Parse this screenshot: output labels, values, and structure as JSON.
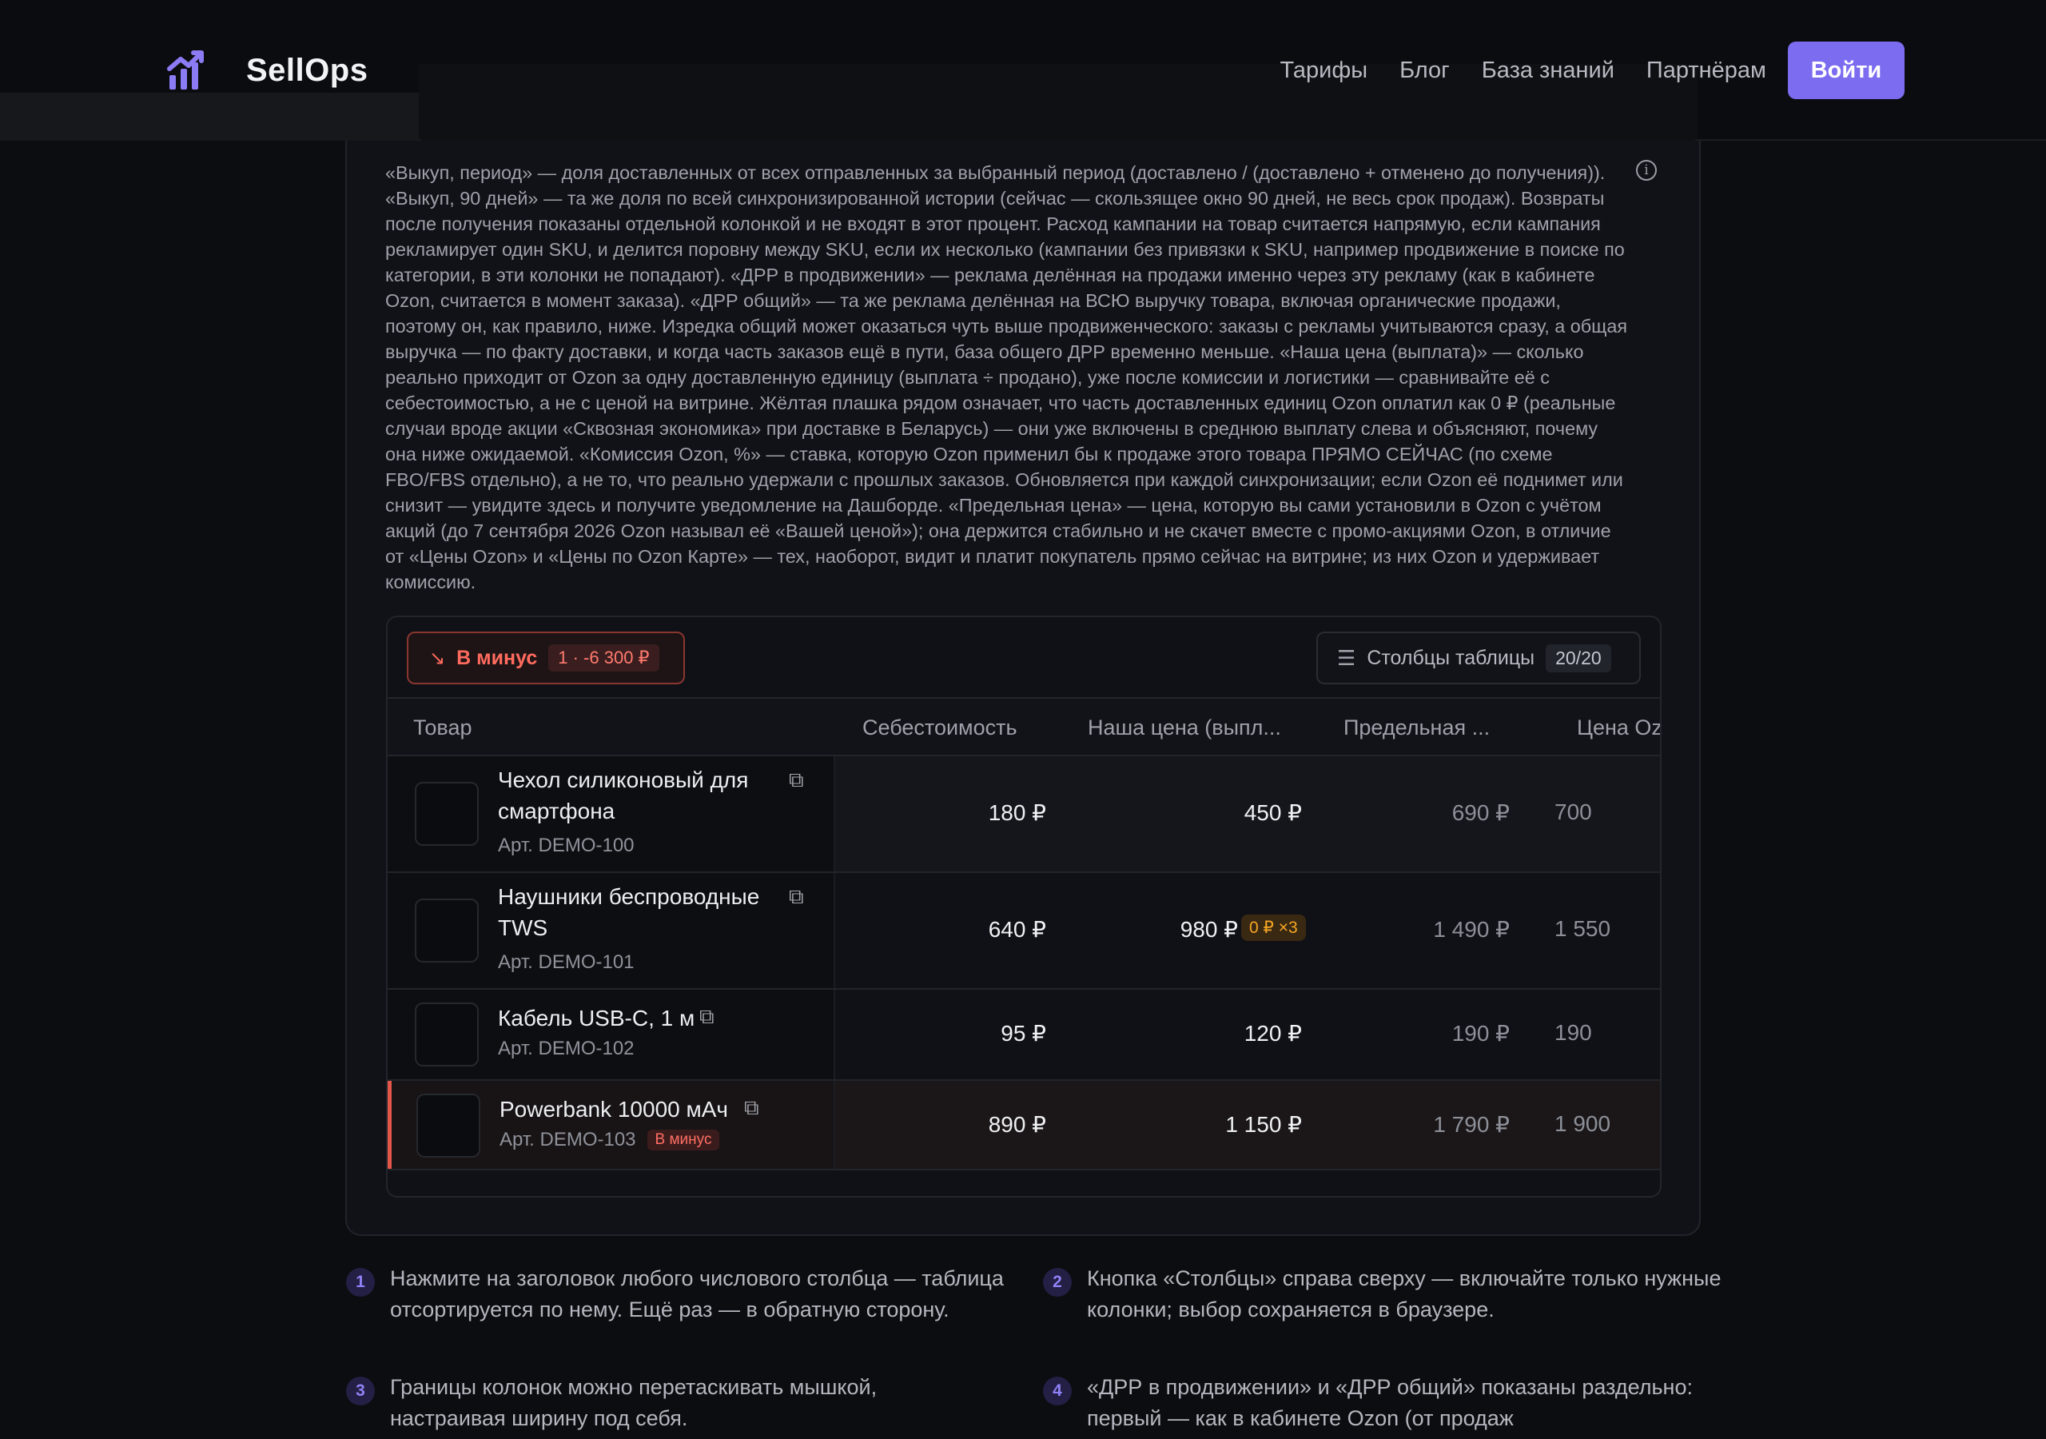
{
  "header": {
    "brand": "SellOps",
    "nav": [
      "Тарифы",
      "Блог",
      "База знаний",
      "Партнёрам"
    ],
    "login": "Войти",
    "accent": "#7b6cf0"
  },
  "description": "«Выкуп, период» — доля доставленных от всех отправленных за выбранный период (доставлено / (доставлено + отменено до получения)). «Выкуп, 90 дней» — та же доля по всей синхронизированной истории (сейчас — скользящее окно 90 дней, не весь срок продаж). Возвраты после получения показаны отдельной колонкой и не входят в этот процент. Расход кампании на товар считается напрямую, если кампания рекламирует один SKU, и делится поровну между SKU, если их несколько (кампании без привязки к SKU, например продвижение в поиске по категории, в эти колонки не попадают). «ДРР в продвижении» — реклама делённая на продажи именно через эту рекламу (как в кабинете Ozon, считается в момент заказа). «ДРР общий» — та же реклама делённая на ВСЮ выручку товара, включая органические продажи, поэтому он, как правило, ниже. Изредка общий может оказаться чуть выше продвиженческого: заказы с рекламы учитываются сразу, а общая выручка — по факту доставки, и когда часть заказов ещё в пути, база общего ДРР временно меньше. «Наша цена (выплата)» — сколько реально приходит от Ozon за одну доставленную единицу (выплата ÷ продано), уже после комиссии и логистики — сравнивайте её с себестоимостью, а не с ценой на витрине. Жёлтая плашка рядом означает, что часть доставленных единиц Ozon оплатил как 0 ₽ (реальные случаи вроде акции «Сквозная экономика» при доставке в Беларусь) — они уже включены в среднюю выплату слева и объясняют, почему она ниже ожидаемой. «Комиссия Ozon, %» — ставка, которую Ozon применил бы к продаже этого товара ПРЯМО СЕЙЧАС (по схеме FBO/FBS отдельно), а не то, что реально удержали с прошлых заказов. Обновляется при каждой синхронизации; если Ozon её поднимет или снизит — увидите здесь и получите уведомление на Дашборде. «Предельная цена» — цена, которую вы сами установили в Ozon с учётом акций (до 7 сентября 2026 Ozon называл её «Вашей ценой»); она держится стабильно и не скачет вместе с промо-акциями Ozon, в отличие от «Цены Ozon» и «Цены по Ozon Карте» — тех, наоборот, видит и платит покупатель прямо сейчас на витрине; из них Ozon и удерживает комиссию.",
  "toolbar": {
    "minus_label": "В минус",
    "minus_badge": "1 · -6 300 ₽",
    "columns_label": "Столбцы таблицы",
    "columns_badge": "20/20"
  },
  "table": {
    "headers": [
      "Товар",
      "Себестоимость",
      "Наша цена (выпл...",
      "Предельная ...",
      "Цена Oz"
    ],
    "rows": [
      {
        "name": "Чехол силиконовый для смартфона",
        "sku": "Арт. DEMO-100",
        "cost": "180 ₽",
        "our_price": "450 ₽",
        "limit_price": "690 ₽",
        "ozon_price": "700"
      },
      {
        "name": "Наушники беспроводные TWS",
        "sku": "Арт. DEMO-101",
        "cost": "640 ₽",
        "our_price": "980 ₽",
        "zero_badge": "0 ₽ ×3",
        "limit_price": "1 490 ₽",
        "ozon_price": "1 550"
      },
      {
        "name": "Кабель USB-C, 1 м",
        "sku": "Арт. DEMO-102",
        "cost": "95 ₽",
        "our_price": "120 ₽",
        "limit_price": "190 ₽",
        "ozon_price": "190"
      },
      {
        "name": "Powerbank 10000 мАч",
        "sku": "Арт. DEMO-103",
        "neg_tag": "В минус",
        "cost": "890 ₽",
        "our_price": "1 150 ₽",
        "limit_price": "1 790 ₽",
        "ozon_price": "1 900"
      }
    ]
  },
  "tips": [
    {
      "n": "1",
      "text": "Нажмите на заголовок любого числового столбца — таблица отсортируется по нему. Ещё раз — в обратную сторону."
    },
    {
      "n": "2",
      "text": "Кнопка «Столбцы» справа сверху — включайте только нужные колонки; выбор сохраняется в браузере."
    },
    {
      "n": "3",
      "text": "Границы колонок можно перетаскивать мышкой, настраивая ширину под себя."
    },
    {
      "n": "4",
      "text": "«ДРР в продвижении» и «ДРР общий» показаны раздельно: первый — как в кабинете Ozon (от продаж"
    }
  ]
}
